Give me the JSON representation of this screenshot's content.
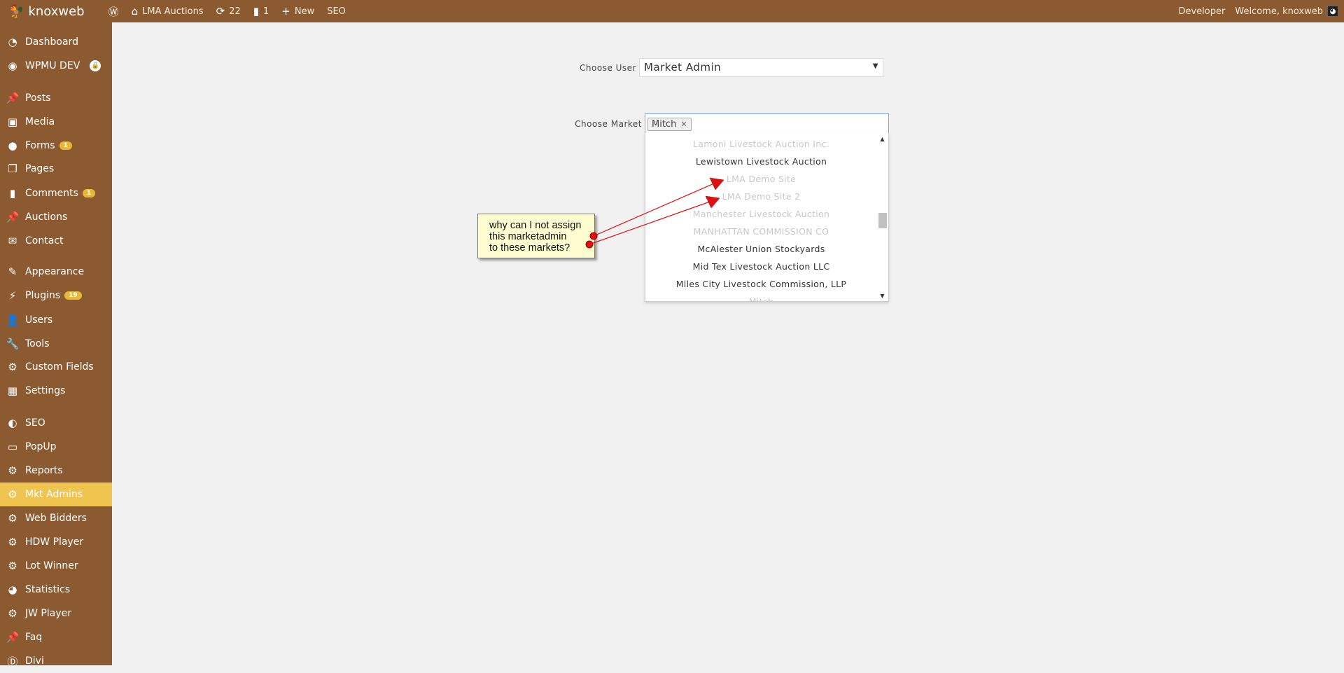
{
  "topbar": {
    "brand": "knoxweb",
    "site": "LMA Auctions",
    "updates": "22",
    "comments": "1",
    "new": "New",
    "seo": "SEO",
    "developer": "Developer",
    "welcome": "Welcome, knoxweb"
  },
  "sidebar": [
    {
      "label": "Dashboard",
      "icon": "dashboard-icon"
    },
    {
      "label": "WPMU DEV",
      "icon": "wpmu-icon",
      "extra": "lock"
    },
    {
      "label": "Posts",
      "icon": "pin-icon"
    },
    {
      "label": "Media",
      "icon": "media-icon"
    },
    {
      "label": "Forms",
      "icon": "forms-icon",
      "badge": "1"
    },
    {
      "label": "Pages",
      "icon": "pages-icon"
    },
    {
      "label": "Comments",
      "icon": "comment-icon",
      "badge": "1"
    },
    {
      "label": "Auctions",
      "icon": "pin-icon"
    },
    {
      "label": "Contact",
      "icon": "mail-icon"
    },
    {
      "label": "Appearance",
      "icon": "brush-icon"
    },
    {
      "label": "Plugins",
      "icon": "plugin-icon",
      "badge": "19"
    },
    {
      "label": "Users",
      "icon": "user-icon"
    },
    {
      "label": "Tools",
      "icon": "wrench-icon"
    },
    {
      "label": "Custom Fields",
      "icon": "gear-icon"
    },
    {
      "label": "Settings",
      "icon": "settings-icon"
    },
    {
      "label": "SEO",
      "icon": "seo-icon"
    },
    {
      "label": "PopUp",
      "icon": "popup-icon"
    },
    {
      "label": "Reports",
      "icon": "gear-icon"
    },
    {
      "label": "Mkt Admins",
      "icon": "gear-icon",
      "active": true
    },
    {
      "label": "Web Bidders",
      "icon": "gear-icon"
    },
    {
      "label": "HDW Player",
      "icon": "gear-icon"
    },
    {
      "label": "Lot Winner",
      "icon": "gear-icon"
    },
    {
      "label": "Statistics",
      "icon": "pie-icon"
    },
    {
      "label": "JW Player",
      "icon": "gear-icon"
    },
    {
      "label": "Faq",
      "icon": "pin-icon"
    },
    {
      "label": "Divi",
      "icon": "divi-icon"
    }
  ],
  "form": {
    "user_label": "Choose User",
    "user_value": "Market Admin",
    "market_label": "Choose Market",
    "selected_tag": "Mitch",
    "remove": "✕"
  },
  "options": [
    {
      "label": "Lamoni Livestock Auction Inc.",
      "disabled": true
    },
    {
      "label": "Lewistown Livestock Auction",
      "disabled": false
    },
    {
      "label": "LMA Demo Site",
      "disabled": true
    },
    {
      "label": "LMA Demo Site 2",
      "disabled": true
    },
    {
      "label": "Manchester Livestock Auction",
      "disabled": true
    },
    {
      "label": "MANHATTAN COMMISSION CO",
      "disabled": true
    },
    {
      "label": "McAlester Union Stockyards",
      "disabled": false
    },
    {
      "label": "Mid Tex Livestock Auction LLC",
      "disabled": false
    },
    {
      "label": "Miles City Livestock Commission, LLP",
      "disabled": false
    },
    {
      "label": "Mitch",
      "disabled": true
    }
  ],
  "note": {
    "lines": [
      "why can I not assign",
      "this marketadmin",
      "to these markets?"
    ]
  },
  "colors": {
    "bar": "#8c5a30",
    "active": "#f0c54f",
    "badge": "#e6b83a",
    "arrow": "#e01010"
  }
}
